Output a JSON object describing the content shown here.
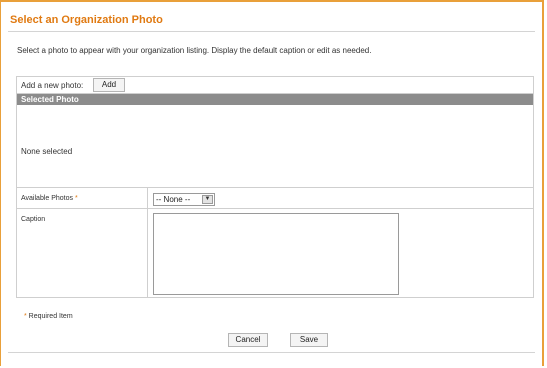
{
  "page": {
    "title": "Select an Organization Photo",
    "intro": "Select a photo to appear with your organization listing. Display the default caption or edit as needed."
  },
  "add_photo": {
    "label": "Add a new photo:",
    "button_label": "Add"
  },
  "selected_photo": {
    "header": "Selected Photo",
    "status": "None selected"
  },
  "available_photos": {
    "label": "Available Photos",
    "required_marker": "*",
    "selected_value": "-- None --",
    "arrow": "▼"
  },
  "caption": {
    "label": "Caption",
    "value": ""
  },
  "footer": {
    "required_marker": "*",
    "required_note": " Required Item",
    "cancel_label": "Cancel",
    "save_label": "Save"
  },
  "colors": {
    "accent": "#e07a12",
    "header_bg": "#8c8c8c"
  }
}
